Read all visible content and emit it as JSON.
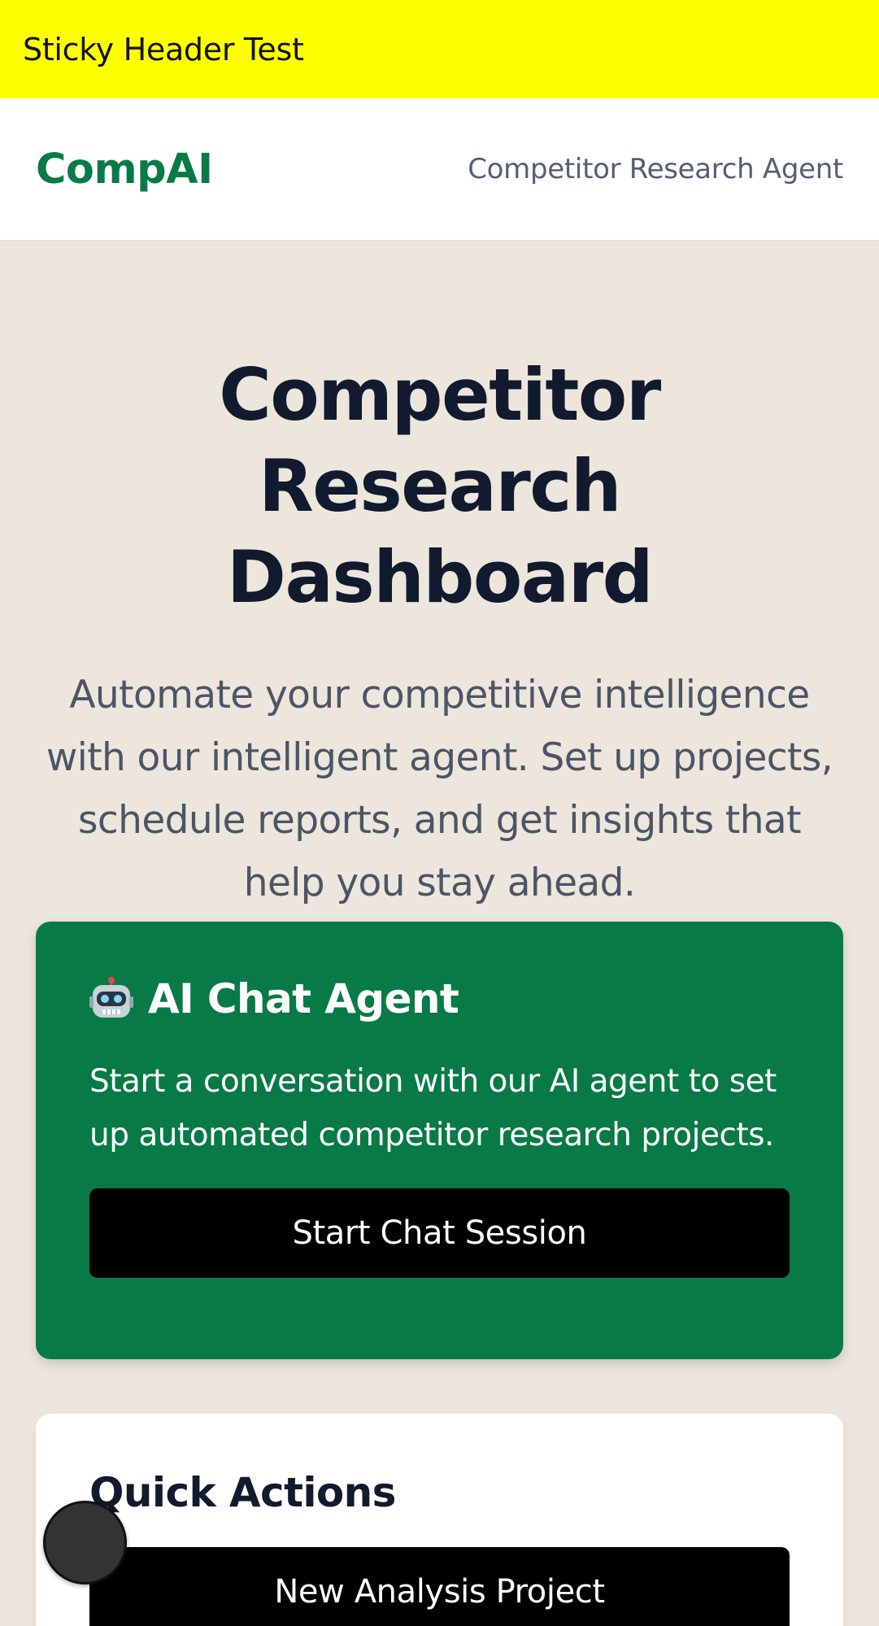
{
  "sticky_header": {
    "text": "Sticky Header Test"
  },
  "navbar": {
    "brand": "CompAI",
    "subtitle": "Competitor Research Agent"
  },
  "hero": {
    "title_line1": "Competitor Research",
    "title_line2": "Dashboard",
    "description": "Automate your competitive intelligence with our intelligent agent. Set up projects, schedule reports, and get insights that help you stay ahead."
  },
  "chat_card": {
    "icon": "robot-icon",
    "title": "AI Chat Agent",
    "description": "Start a conversation with our AI agent to set up automated competitor research projects.",
    "button_label": "Start Chat Session"
  },
  "quick_actions": {
    "title": "Quick Actions",
    "buttons": [
      "New Analysis Project"
    ]
  },
  "colors": {
    "sticky_bg": "#ffff00",
    "brand_green": "#087a46",
    "page_bg": "#ede6dc",
    "button_bg": "#000000"
  }
}
